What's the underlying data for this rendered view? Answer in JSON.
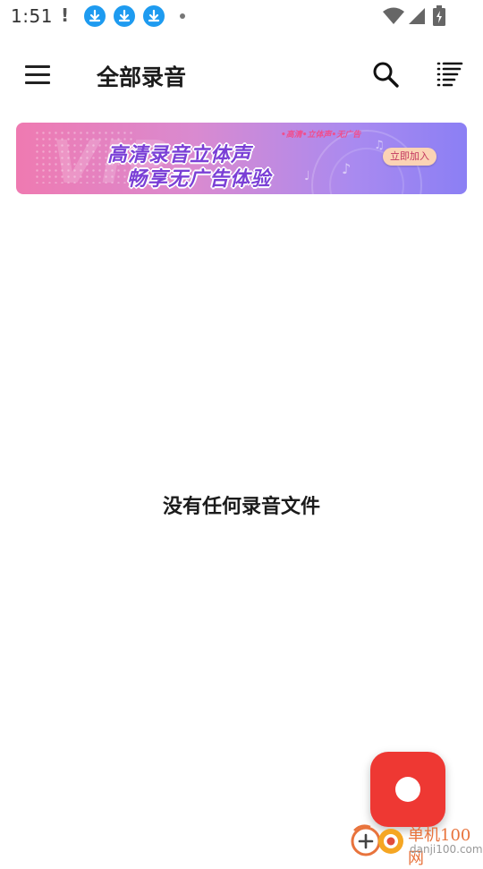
{
  "status_bar": {
    "time": "1:51",
    "alert": "!",
    "icons": [
      "download-icon",
      "download-icon",
      "download-icon",
      "dot-icon",
      "wifi-icon",
      "signal-icon",
      "battery-icon"
    ]
  },
  "app_bar": {
    "title": "全部录音",
    "icons": [
      "menu-icon",
      "search-icon",
      "sort-icon"
    ]
  },
  "banner": {
    "tag": "•高清•立体声•无广告",
    "line1": "高清录音立体声",
    "line2": "畅享无广告体验",
    "cta": "立即加入",
    "watermark": "VIP",
    "colors": [
      "#ef7ab1",
      "#a98af0",
      "#8b7ff4"
    ]
  },
  "empty_state": {
    "message": "没有任何录音文件"
  },
  "fab": {
    "icon": "record-icon",
    "color": "#ee3833"
  },
  "watermark": {
    "name": "单机100网",
    "url": "danji100.com"
  }
}
